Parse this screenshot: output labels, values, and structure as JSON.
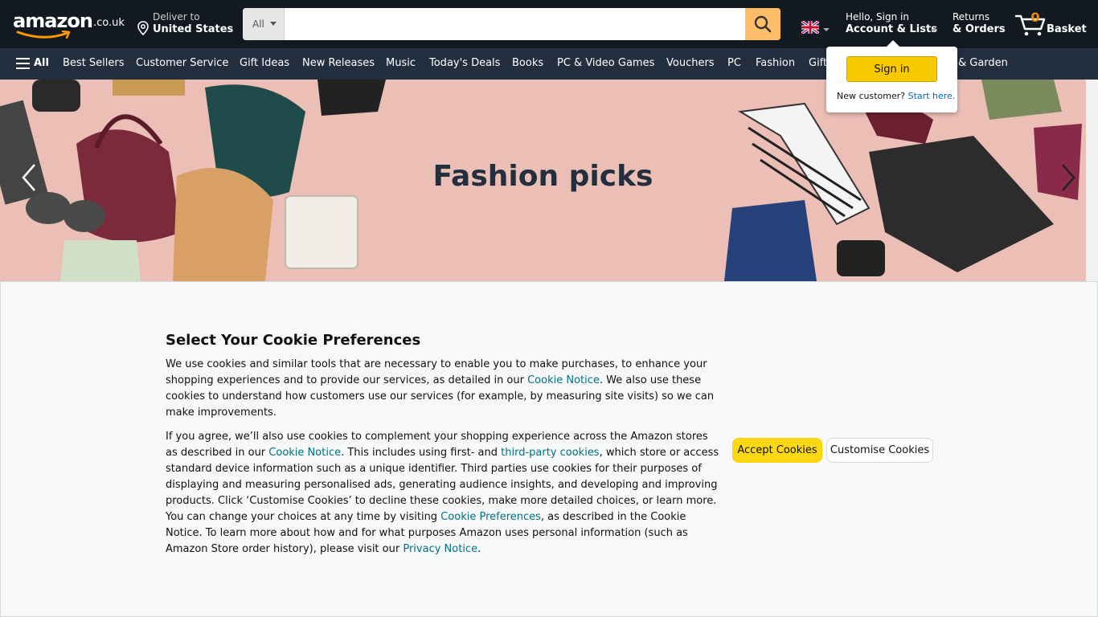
{
  "header": {
    "logo_text": "amazon",
    "logo_tld": ".co.uk",
    "deliver_line1": "Deliver to",
    "deliver_line2": "United States",
    "search_category": "All",
    "search_placeholder": "",
    "account_line1": "Hello, Sign in",
    "account_line2": "Account & Lists",
    "returns_line1": "Returns",
    "returns_line2": "& Orders",
    "basket_count": "0",
    "basket_label": "Basket"
  },
  "nav": {
    "all_label": "All",
    "items": [
      "Best Sellers",
      "Customer Service",
      "Gift Ideas",
      "New Releases",
      "Music",
      "Today's Deals",
      "Books",
      "PC & Video Games",
      "Vouchers",
      "PC",
      "Fashion",
      "Gift",
      "& Garden"
    ]
  },
  "hero": {
    "title": "Fashion picks"
  },
  "signin_popover": {
    "button": "Sign in",
    "new_customer": "New customer?",
    "start_here": "Start here."
  },
  "cookie": {
    "title": "Select Your Cookie Preferences",
    "p1_a": "We use cookies and similar tools that are necessary to enable you to make purchases, to enhance your shopping experiences and to provide our services, as detailed in our ",
    "p1_link": "Cookie Notice",
    "p1_b": ". We also use these cookies to understand how customers use our services (for example, by measuring site visits) so we can make improvements.",
    "p2_a": "If you agree, we’ll also use cookies to complement your shopping experience across the Amazon stores as described in our ",
    "p2_link1": "Cookie Notice",
    "p2_b": ". This includes using first- and ",
    "p2_link2": "third-party cookies",
    "p2_c": ", which store or access standard device information such as a unique identifier. Third parties use cookies for their purposes of displaying and measuring personalised ads, generating audience insights, and developing and improving products. Click ‘Customise Cookies’ to decline these cookies, make more detailed choices, or learn more. You can change your choices at any time by visiting ",
    "p2_link3": "Cookie Preferences",
    "p2_d": ", as described in the Cookie Notice. To learn more about how and for what purposes Amazon uses personal information (such as Amazon Store order history), please visit our ",
    "p2_link4": "Privacy Notice",
    "p2_e": ".",
    "accept_label": "Accept Cookies",
    "customise_label": "Customise Cookies"
  },
  "colors": {
    "header_bg": "#131921",
    "nav_bg": "#232f3e",
    "accent": "#febd69",
    "accept_button": "#ffd814",
    "link": "#007185",
    "hero_bg": "#ecbfb6"
  },
  "icons": {
    "location": "location-pin-icon",
    "search": "search-icon",
    "cart": "cart-icon",
    "flag": "uk-flag-icon",
    "menu": "hamburger-menu-icon",
    "prev": "chevron-left-icon",
    "next": "chevron-right-icon"
  }
}
